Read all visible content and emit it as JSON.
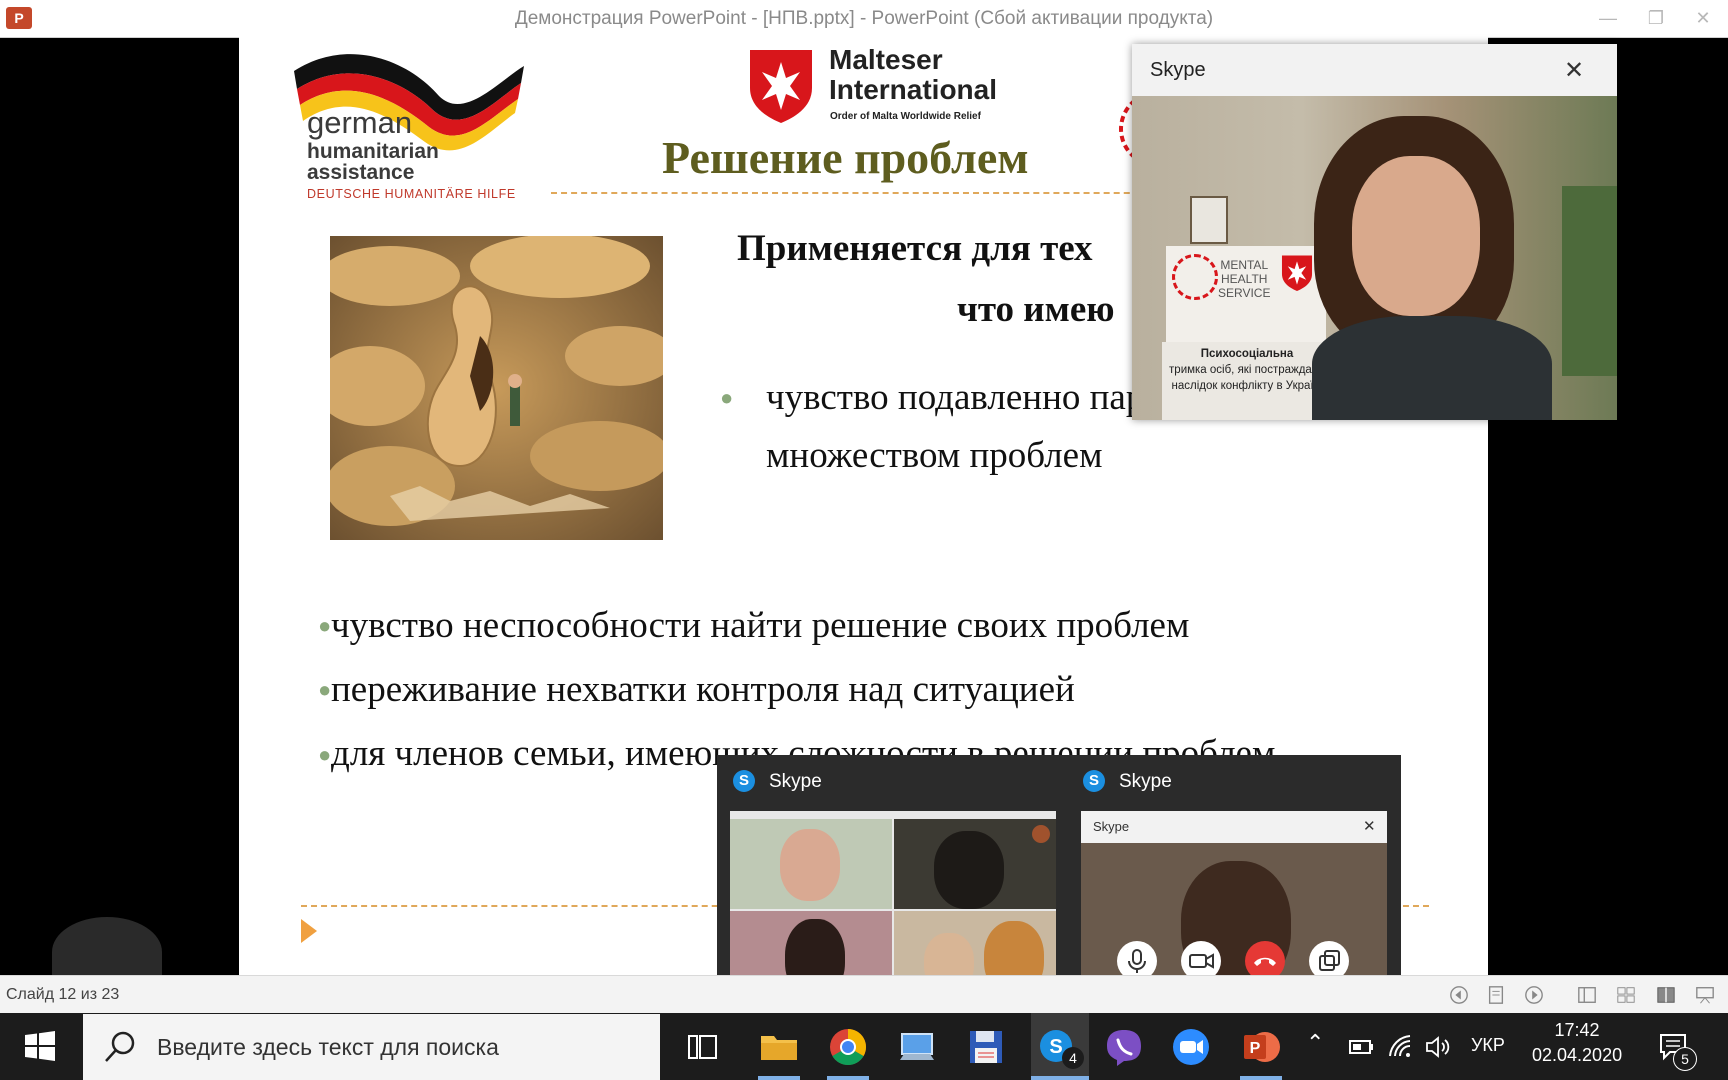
{
  "window": {
    "title": "Демонстрация PowerPoint - [НПВ.pptx] - PowerPoint (Сбой активации продукта)",
    "app_logo_text": "P"
  },
  "slide": {
    "logo_gha": {
      "line1": "german",
      "line2": "humanitarian",
      "line3": "assistance",
      "line4": "DEUTSCHE HUMANITÄRE HILFE"
    },
    "logo_malteser": {
      "line1": "Malteser",
      "line2": "International",
      "line3": "Order of Malta Worldwide Relief"
    },
    "title": "Решение проблем",
    "subtitle_line1": "Применяется для тех",
    "subtitle_line2": "что имею",
    "bullet_right": "чувство подавленно паралізованности множеством проблем",
    "bullets": [
      "чувство неспособности найти решение своих проблем",
      "переживание нехватки контроля над ситуацией",
      "для членов семьи, имеющих сложности в решении проблем"
    ]
  },
  "status": {
    "slide_counter": "Слайд 12 из 23"
  },
  "skype_main": {
    "title": "Skype",
    "sign_line1": "MENTAL",
    "sign_line2": "HEALTH",
    "sign_line3": "SERVICE",
    "poster_line1": "Психосоціальна",
    "poster_line2": "тримка осіб, які постраждали",
    "poster_line3": "наслідок конфлікту в Україні"
  },
  "skype_thumbs": {
    "left_title": "Skype",
    "right_title": "Skype",
    "inner_title": "Skype"
  },
  "taskbar": {
    "search_placeholder": "Введите здесь текст для поиска",
    "skype_badge": "4",
    "language": "УКР",
    "time": "17:42",
    "date": "02.04.2020",
    "notification_count": "5"
  },
  "colors": {
    "title_olive": "#5e5d1f",
    "bullet_green": "#8aa87b",
    "accent_orange": "#e0a85a",
    "skype_blue": "#1b8fe0",
    "end_call_red": "#e53935"
  }
}
